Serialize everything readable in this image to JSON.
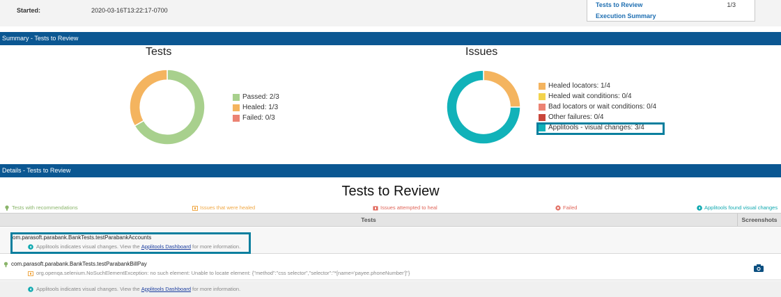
{
  "header": {
    "started_label": "Started:",
    "started_value": "2020-03-16T13:22:17-0700",
    "toc": [
      {
        "label": "Tests to Review",
        "count": "1/3"
      },
      {
        "label": "Execution Summary",
        "count": ""
      }
    ]
  },
  "summary": {
    "bar_title": "Summary - Tests to Review",
    "tests_chart": {
      "title": "Tests",
      "legend": [
        {
          "label": "Passed:  2/3",
          "color": "#a8d08d"
        },
        {
          "label": "Healed:  1/3",
          "color": "#f4b45f"
        },
        {
          "label": "Failed:  0/3",
          "color": "#ec8373"
        }
      ]
    },
    "issues_chart": {
      "title": "Issues",
      "legend": [
        {
          "label": "Healed locators:  1/4",
          "color": "#f4b45f"
        },
        {
          "label": "Healed wait conditions:  0/4",
          "color": "#f3d34c"
        },
        {
          "label": "Bad locators or wait conditions:  0/4",
          "color": "#ec8373"
        },
        {
          "label": "Other failures:  0/4",
          "color": "#c9463b"
        },
        {
          "label": "Applitools - visual changes:  3/4",
          "color": "#11b2b9"
        }
      ]
    }
  },
  "chart_data": [
    {
      "type": "pie",
      "title": "Tests",
      "categories": [
        "Passed",
        "Healed",
        "Failed"
      ],
      "values": [
        2,
        1,
        0
      ],
      "colors": [
        "#a8d08d",
        "#f4b45f",
        "#ec8373"
      ]
    },
    {
      "type": "pie",
      "title": "Issues",
      "categories": [
        "Healed locators",
        "Healed wait conditions",
        "Bad locators or wait conditions",
        "Other failures",
        "Applitools - visual changes"
      ],
      "values": [
        1,
        0,
        0,
        0,
        3
      ],
      "colors": [
        "#f4b45f",
        "#f3d34c",
        "#ec8373",
        "#c9463b",
        "#11b2b9"
      ]
    }
  ],
  "details": {
    "bar_title": "Details - Tests to Review",
    "title": "Tests to Review",
    "key": [
      {
        "label": "Tests with recommendations",
        "color": "#8ab56a"
      },
      {
        "label": "Issues that were healed",
        "color": "#f0a845"
      },
      {
        "label": "Issues attempted to heal",
        "color": "#e0665a"
      },
      {
        "label": "Failed",
        "color": "#e0665a"
      },
      {
        "label": "Applitools found visual changes",
        "color": "#11a9b0"
      }
    ],
    "table": {
      "col_tests": "Tests",
      "col_screenshots": "Screenshots",
      "rows": [
        {
          "name": "om.parasoft.parabank.BankTests.testParabankAccounts",
          "detail_pre": "Applitools indicates visual changes. View the",
          "detail_link": "Applitools Dashboard",
          "detail_post": "for more information."
        },
        {
          "name": "com.parasoft.parabank.BankTests.testParabankBillPay",
          "error": "org.openqa.selenium.NoSuchElementException: no such element: Unable to locate element: {\"method\":\"css selector\",\"selector\":\"*[name='payee.phoneNumber']\"}",
          "detail_pre": "Applitools indicates visual changes. View the",
          "detail_link": "Applitools Dashboard",
          "detail_post": "for more information."
        }
      ]
    }
  }
}
